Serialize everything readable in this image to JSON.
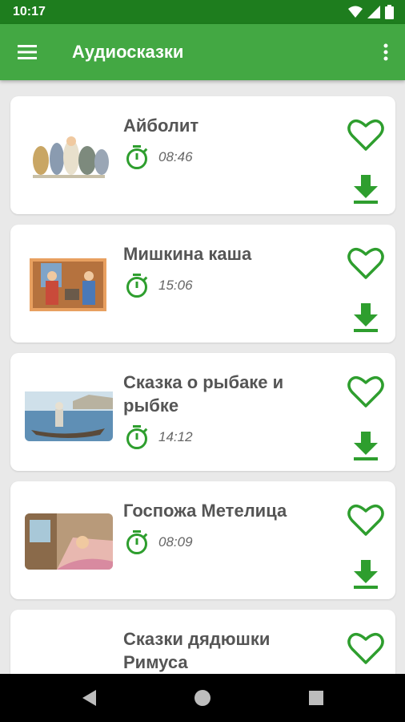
{
  "status_bar": {
    "time": "10:17",
    "icons": [
      "wifi-icon",
      "signal-icon",
      "battery-icon"
    ]
  },
  "app_bar": {
    "title": "Аудиосказки",
    "menu_icon": "hamburger-menu-icon",
    "more_icon": "more-vertical-icon"
  },
  "colors": {
    "status_bar": "#1e7d1e",
    "app_bar": "#43a843",
    "accent_green": "#2e9e2e",
    "background": "#e9e9e9",
    "card": "#ffffff",
    "title_text": "#555555",
    "duration_text": "#666666"
  },
  "stories": [
    {
      "title": "Айболит",
      "duration": "08:46"
    },
    {
      "title": "Мишкина каша",
      "duration": "15:06"
    },
    {
      "title": "Сказка о рыбаке и рыбке",
      "duration": "14:12"
    },
    {
      "title": "Госпожа Метелица",
      "duration": "08:09"
    },
    {
      "title": "Сказки дядюшки Римуса",
      "duration": ""
    }
  ],
  "nav_bar": {
    "icons": [
      "back-icon",
      "home-icon",
      "recents-icon"
    ]
  }
}
